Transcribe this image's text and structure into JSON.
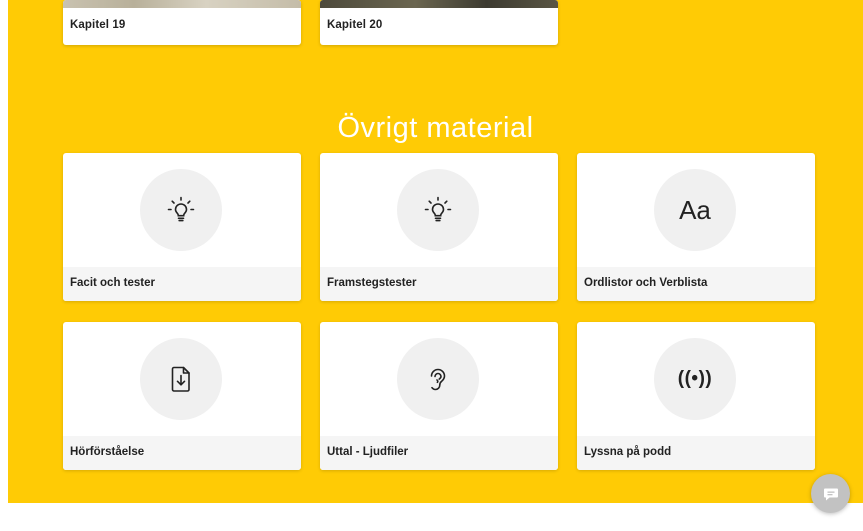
{
  "chapters": [
    {
      "label": "Kapitel 19"
    },
    {
      "label": "Kapitel 20"
    }
  ],
  "section": {
    "title": "Övrigt material"
  },
  "materials": [
    {
      "label": "Facit och tester",
      "icon": "lightbulb-icon"
    },
    {
      "label": "Framstegstester",
      "icon": "lightbulb-icon"
    },
    {
      "label": "Ordlistor och Verblista",
      "icon": "Aa",
      "icon_text": "Aa"
    },
    {
      "label": "Hörförståelse",
      "icon": "download-file-icon"
    },
    {
      "label": "Uttal - Ljudfiler",
      "icon": "ear-icon"
    },
    {
      "label": "Lyssna på podd",
      "icon": "broadcast-icon",
      "icon_text": "((•))"
    }
  ],
  "colors": {
    "background": "#ffcb05",
    "card": "#ffffff",
    "caption_bar": "#f5f5f5",
    "icon_circle": "#f0f0f0",
    "chat_button": "#c2c2c2"
  }
}
